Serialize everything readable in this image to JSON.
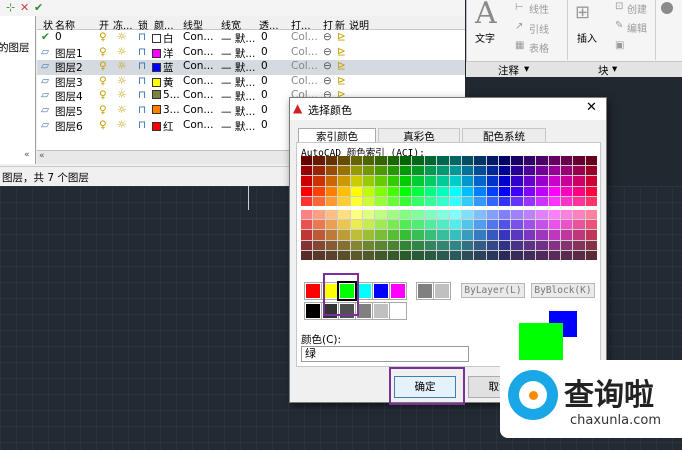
{
  "layer_palette": {
    "left_pane_text": "的图层",
    "columns": [
      "状",
      "名称",
      "开",
      "冻...",
      "锁",
      "颜...",
      "线型",
      "线宽",
      "透...",
      "打...",
      "打",
      "新",
      "说明"
    ],
    "rows": [
      {
        "status": "✔",
        "name": "0",
        "color_name": "白",
        "color": "#ffffff",
        "linetype": "Con...",
        "lineweight": "— 默...",
        "transparency": "0",
        "plot_style": "Col...",
        "selected": false
      },
      {
        "status": "▱",
        "name": "图层1",
        "color_name": "洋",
        "color": "#ff00ff",
        "linetype": "Con...",
        "lineweight": "— 默...",
        "transparency": "0",
        "plot_style": "Col...",
        "selected": false
      },
      {
        "status": "▱",
        "name": "图层2",
        "color_name": "蓝",
        "color": "#0000ff",
        "linetype": "Con...",
        "lineweight": "— 默...",
        "transparency": "0",
        "plot_style": "Col...",
        "selected": true
      },
      {
        "status": "▱",
        "name": "图层3",
        "color_name": "黄",
        "color": "#ffff00",
        "linetype": "Con...",
        "lineweight": "— 默...",
        "transparency": "0",
        "plot_style": "Col...",
        "selected": false
      },
      {
        "status": "▱",
        "name": "图层4",
        "color_name": "5...",
        "color": "#7f7f3f",
        "linetype": "Con...",
        "lineweight": "— 默...",
        "transparency": "0",
        "plot_style": "Col...",
        "selected": false
      },
      {
        "status": "▱",
        "name": "图层5",
        "color_name": "3...",
        "color": "#ff7f00",
        "linetype": "Con...",
        "lineweight": "— 默...",
        "transparency": "0",
        "plot_style": "Col...",
        "selected": false
      },
      {
        "status": "▱",
        "name": "图层6",
        "color_name": "红",
        "color": "#ff0000",
        "linetype": "Con...",
        "lineweight": "— 默...",
        "transparency": "0",
        "plot_style": "Col...",
        "selected": false
      }
    ],
    "status_text": "图层，共 7 个图层",
    "collapse_glyph": "«"
  },
  "ribbon": {
    "text_label": "文字",
    "linear_label": "线性",
    "leader_label": "引线",
    "table_label": "表格",
    "insert_label": "插入",
    "create_label": "创建",
    "edit_label": "编辑",
    "annotation_panel": "注释",
    "block_panel": "块",
    "dropdown_glyph": "▾"
  },
  "dialog": {
    "title": "选择颜色",
    "close_glyph": "✕",
    "tabs": [
      "索引颜色",
      "真彩色",
      "配色系统"
    ],
    "aci_label": "AutoCAD 颜色索引 (ACI):",
    "bylayer_label": "ByLayer(L)",
    "byblock_label": "ByBlock(K)",
    "color_field_label": "颜色(C):",
    "color_field_value": "绿",
    "ok_label": "确定",
    "cancel_label": "取消",
    "current_color": "#00ff00",
    "previous_color": "#0000ff",
    "standard_colors": [
      "#ff0000",
      "#ffff00",
      "#00ff00",
      "#00ffff",
      "#0000ff",
      "#ff00ff"
    ],
    "gray_colors_row1": [
      "#808080",
      "#c0c0c0"
    ],
    "gray_colors_row2": [
      "#000000",
      "#333333",
      "#505050",
      "#808080",
      "#c0c0c0",
      "#ffffff"
    ]
  },
  "watermark": {
    "brand": "查询啦",
    "url": "chaxunla.com"
  }
}
